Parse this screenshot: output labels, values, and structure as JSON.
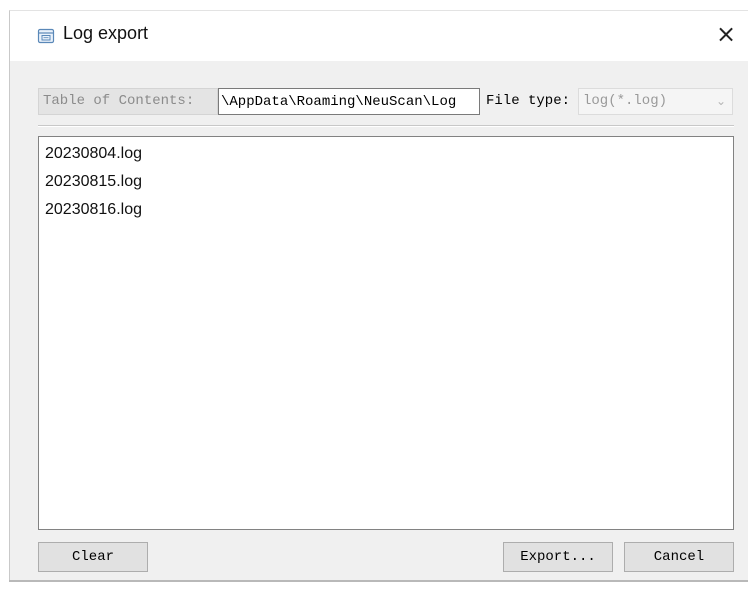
{
  "window": {
    "title": "Log export",
    "close_glyph": "×",
    "icon": "app-window-icon"
  },
  "toolbar": {
    "toc_label": "Table of Contents:",
    "path_value": "AppData\\Roaming\\NeuScan\\Log\\",
    "file_type_label": "File type:",
    "file_type_value": "log(*.log)"
  },
  "file_list": {
    "items": [
      "20230804.log",
      "20230815.log",
      "20230816.log"
    ]
  },
  "buttons": {
    "clear": "Clear",
    "export": "Export...",
    "cancel": "Cancel"
  },
  "colors": {
    "dialog_background": "#f0f0f0",
    "list_background": "#ffffff",
    "disabled_text": "#8b8b8b",
    "icon_accent": "#5a88b8"
  }
}
